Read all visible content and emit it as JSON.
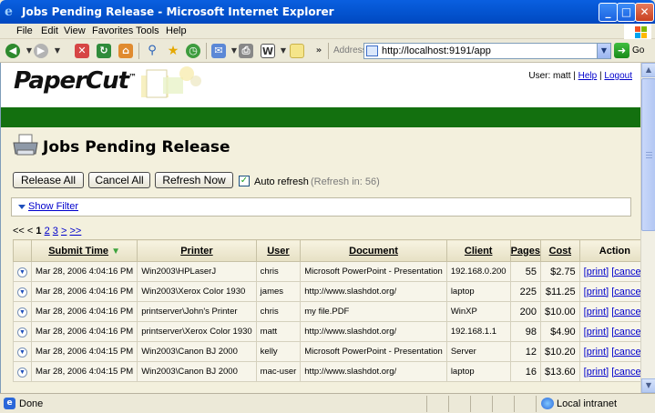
{
  "window": {
    "title": "Jobs Pending Release - Microsoft Internet Explorer"
  },
  "menu": {
    "items": [
      "File",
      "Edit",
      "View",
      "Favorites",
      "Tools",
      "Help"
    ]
  },
  "address": {
    "label": "Address",
    "url": "http://localhost:9191/app",
    "go_label": "Go"
  },
  "header": {
    "logo": "PaperCut",
    "logo_tm": "™",
    "user_prefix": "User: matt |",
    "help": "Help",
    "logout": "Logout",
    "separator": "|"
  },
  "page": {
    "title": "Jobs Pending Release"
  },
  "actions": {
    "release_all": "Release All",
    "cancel_all": "Cancel All",
    "refresh_now": "Refresh Now",
    "auto_refresh_label": "Auto refresh",
    "auto_refresh_checked": true,
    "refresh_countdown": "(Refresh in: 56)"
  },
  "filter": {
    "label": "Show Filter"
  },
  "pager": {
    "first": "<<",
    "prev": "<",
    "current": "1",
    "p2": "2",
    "p3": "3",
    "next": ">",
    "last": ">>"
  },
  "table": {
    "headers": {
      "submit_time": "Submit Time",
      "sort_indicator": "▼",
      "printer": "Printer",
      "user": "User",
      "document": "Document",
      "client": "Client",
      "pages": "Pages",
      "cost": "Cost",
      "action": "Action"
    },
    "print_link": "[print]",
    "cancel_link": "[cancel]",
    "rows": [
      {
        "submit_time": "Mar 28, 2006 4:04:16 PM",
        "printer": "Win2003\\HPLaserJ",
        "user": "chris",
        "document": "Microsoft PowerPoint - Presentation",
        "client": "192.168.0.200",
        "pages": "55",
        "cost": "$2.75"
      },
      {
        "submit_time": "Mar 28, 2006 4:04:16 PM",
        "printer": "Win2003\\Xerox Color 1930",
        "user": "james",
        "document": "http://www.slashdot.org/",
        "client": "laptop",
        "pages": "225",
        "cost": "$11.25"
      },
      {
        "submit_time": "Mar 28, 2006 4:04:16 PM",
        "printer": "printserver\\John's Printer",
        "user": "chris",
        "document": "my file.PDF",
        "client": "WinXP",
        "pages": "200",
        "cost": "$10.00"
      },
      {
        "submit_time": "Mar 28, 2006 4:04:16 PM",
        "printer": "printserver\\Xerox Color 1930",
        "user": "matt",
        "document": "http://www.slashdot.org/",
        "client": "192.168.1.1",
        "pages": "98",
        "cost": "$4.90"
      },
      {
        "submit_time": "Mar 28, 2006 4:04:15 PM",
        "printer": "Win2003\\Canon BJ 2000",
        "user": "kelly",
        "document": "Microsoft PowerPoint - Presentation",
        "client": "Server",
        "pages": "12",
        "cost": "$10.20"
      },
      {
        "submit_time": "Mar 28, 2006 4:04:15 PM",
        "printer": "Win2003\\Canon BJ 2000",
        "user": "mac-user",
        "document": "http://www.slashdot.org/",
        "client": "laptop",
        "pages": "16",
        "cost": "$13.60"
      }
    ]
  },
  "status": {
    "left": "Done",
    "zone": "Local intranet"
  },
  "colors": {
    "green_bar": "#13700F",
    "link": "#0000CC",
    "title_bar": "#0454D0"
  }
}
